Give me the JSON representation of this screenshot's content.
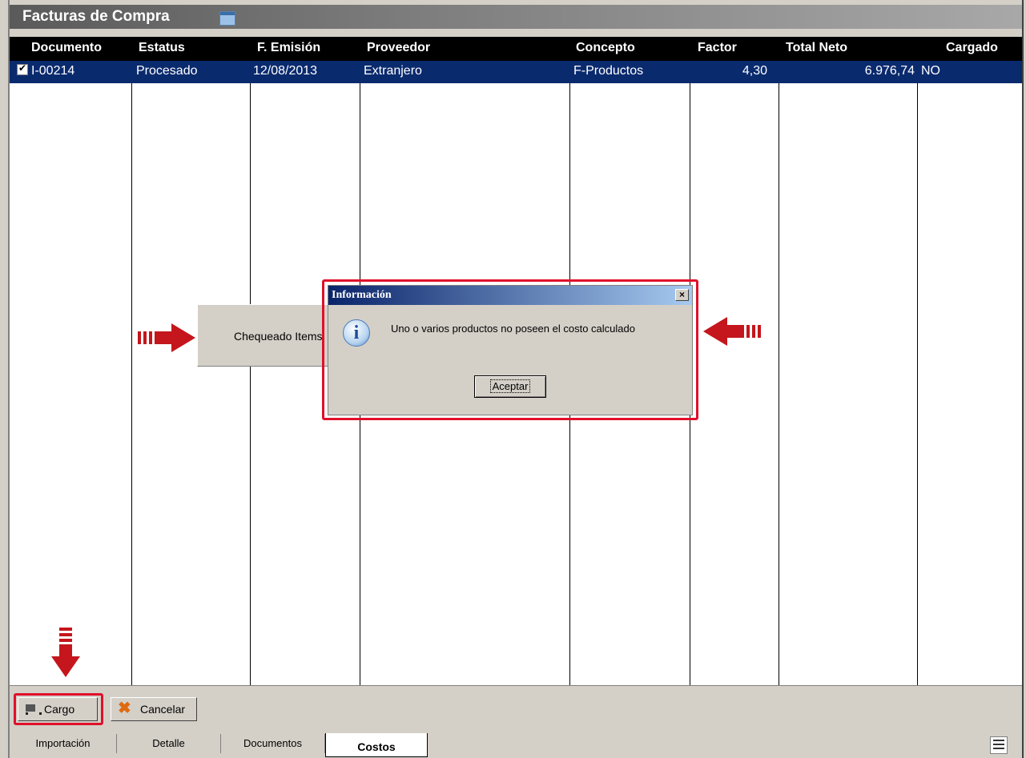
{
  "window": {
    "title": "Facturas de Compra"
  },
  "table": {
    "headers": [
      "Documento",
      "Estatus",
      "F. Emisión",
      "Proveedor",
      "Concepto",
      "Factor",
      "Total Neto",
      "Cargado"
    ],
    "rows": [
      {
        "documento": "I-00214",
        "estatus": "Procesado",
        "emision": "12/08/2013",
        "proveedor": "Extranjero",
        "concepto": "F-Productos",
        "factor": "4,30",
        "total": "6.976,74",
        "cargado": "NO",
        "checked": true
      }
    ]
  },
  "progress": {
    "text": "Chequeado Items"
  },
  "dialog": {
    "title": "Información",
    "message": "Uno o varios productos no poseen el costo calculado",
    "ok_label": "Aceptar",
    "close_label": "×"
  },
  "toolbar": {
    "cargo_label": "Cargo",
    "cancelar_label": "Cancelar"
  },
  "tabs": [
    "Importación",
    "Detalle",
    "Documentos",
    "Costos"
  ],
  "active_tab": "Costos",
  "colors": {
    "selected_row": "#0a2a6e",
    "highlight": "#e0102a",
    "arrow": "#c4161c"
  }
}
